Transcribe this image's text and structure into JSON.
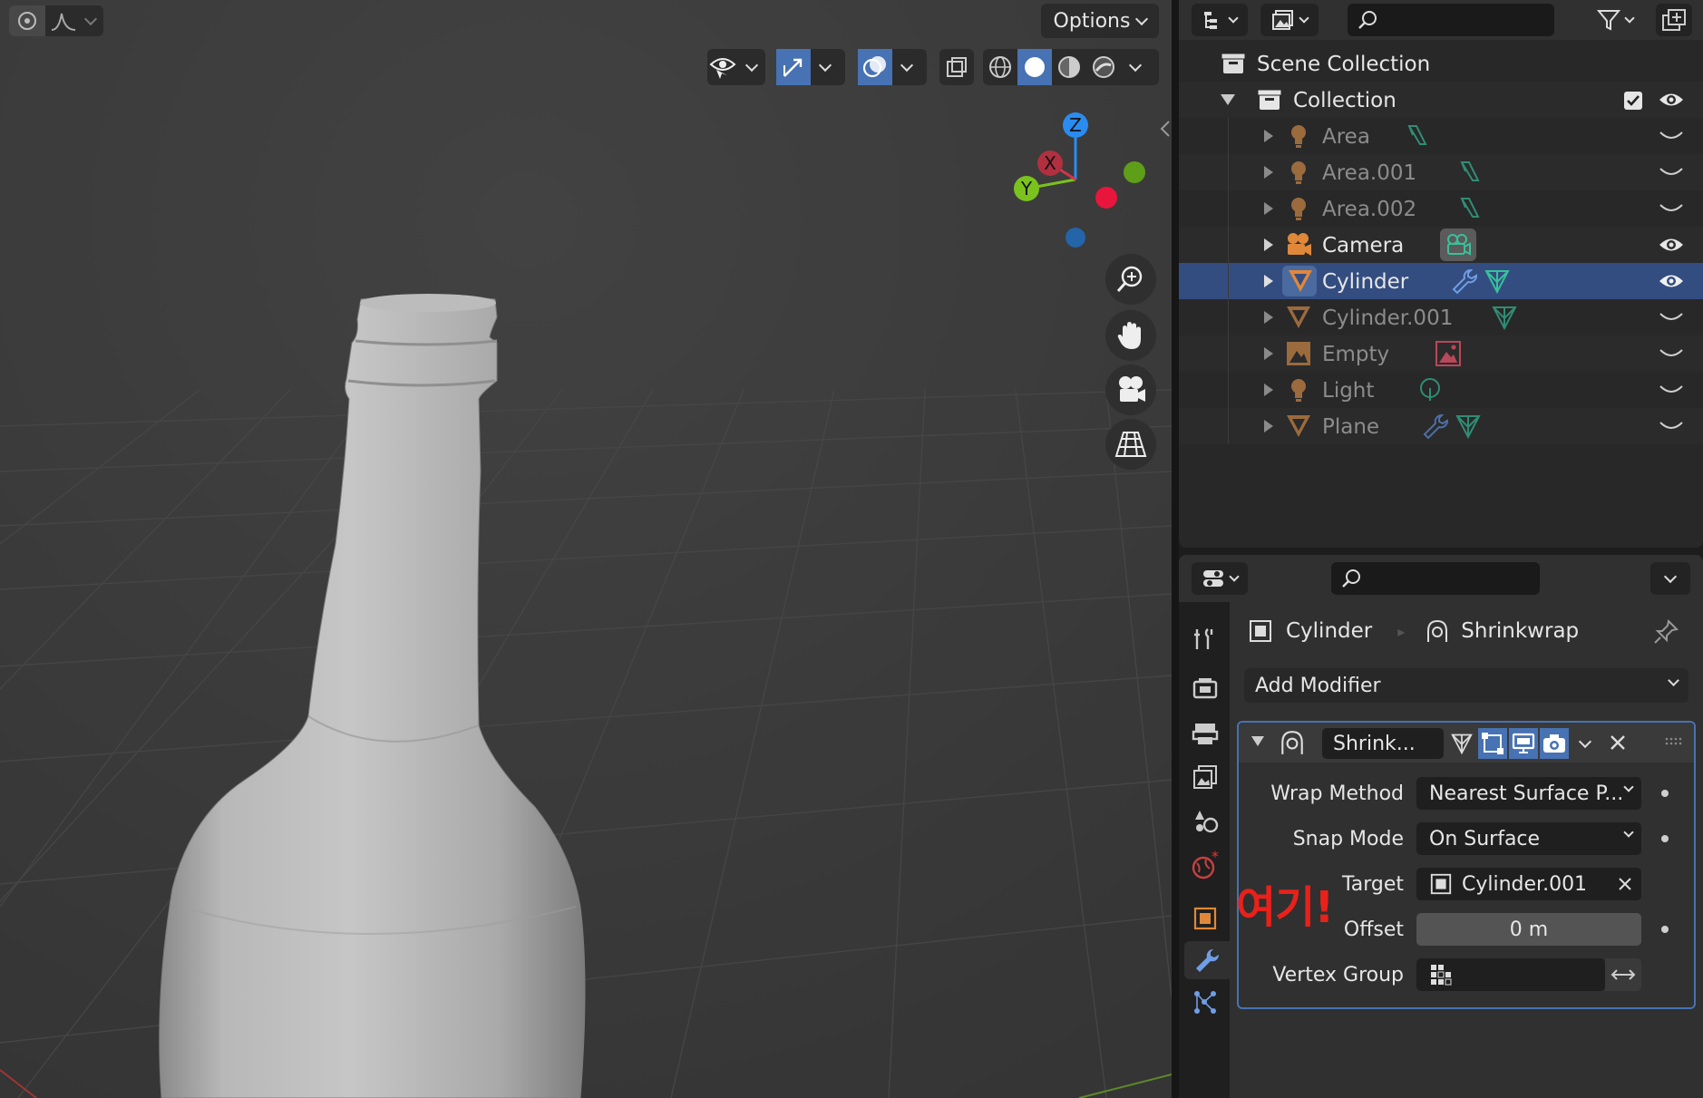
{
  "viewport": {
    "options_label": "Options",
    "gizmo": {
      "z": "Z",
      "x": "X",
      "y": "Y"
    }
  },
  "outliner": {
    "scene_collection": "Scene Collection",
    "collection": "Collection",
    "items": [
      {
        "label": "Area",
        "type": "light",
        "extra": "light-data-icon",
        "visible": false
      },
      {
        "label": "Area.001",
        "type": "light",
        "extra": "light-data-icon",
        "visible": false
      },
      {
        "label": "Area.002",
        "type": "light",
        "extra": "light-data-icon",
        "visible": false
      },
      {
        "label": "Camera",
        "type": "camera",
        "extra": "camera-data-icon",
        "visible": true
      },
      {
        "label": "Cylinder",
        "type": "mesh",
        "extra": "modifier-and-mesh-icons",
        "visible": true,
        "selected": true
      },
      {
        "label": "Cylinder.001",
        "type": "mesh",
        "extra": "mesh-data-icon",
        "visible": false
      },
      {
        "label": "Empty",
        "type": "empty",
        "extra": "image-data-icon",
        "visible": false
      },
      {
        "label": "Light",
        "type": "light",
        "extra": "point-light-icon",
        "visible": false
      },
      {
        "label": "Plane",
        "type": "mesh",
        "extra": "modifier-and-mesh-icons",
        "visible": false
      }
    ]
  },
  "properties": {
    "breadcrumb_object": "Cylinder",
    "breadcrumb_modifier": "Shrinkwrap",
    "add_modifier": "Add Modifier",
    "modifier": {
      "name": "Shrink...",
      "wrap_method_label": "Wrap Method",
      "wrap_method_value": "Nearest Surface P...",
      "snap_mode_label": "Snap Mode",
      "snap_mode_value": "On Surface",
      "target_label": "Target",
      "target_value": "Cylinder.001",
      "offset_label": "Offset",
      "offset_value": "0 m",
      "vertex_group_label": "Vertex Group",
      "vertex_group_value": ""
    }
  },
  "annotation": "여기!",
  "colors": {
    "accent": "#4772b3",
    "annotation": "#e8211a",
    "mesh_orange": "#e0883a"
  }
}
